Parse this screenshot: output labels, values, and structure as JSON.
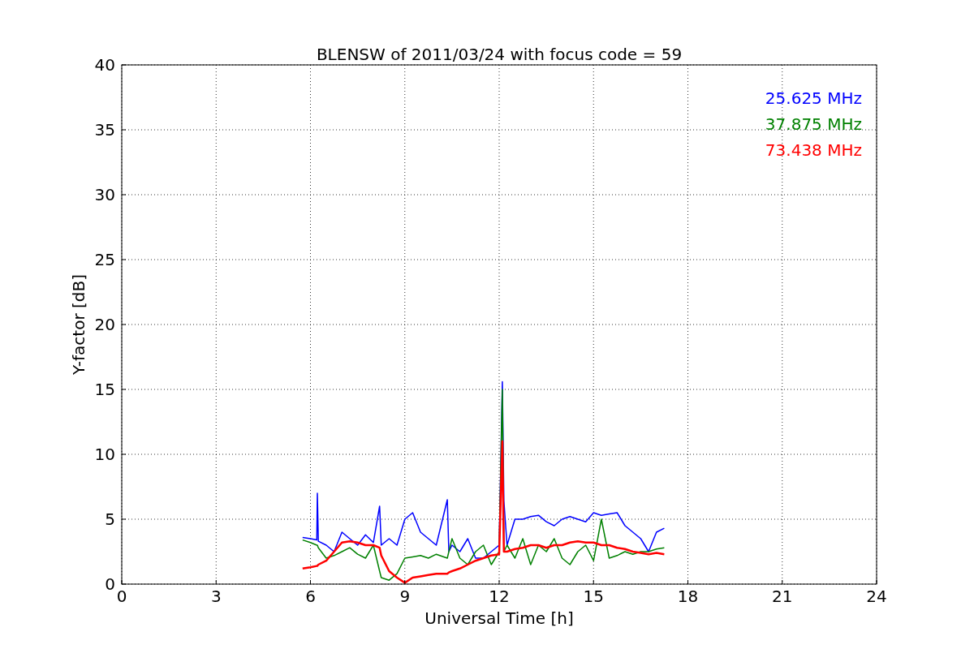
{
  "chart_data": {
    "type": "line",
    "grid": true,
    "title": "BLENSW of 2011/03/24 with focus code = 59",
    "xlabel": "Universal Time [h]",
    "ylabel": "Y-factor [dB]",
    "xlim": [
      0,
      24
    ],
    "ylim": [
      0,
      40
    ],
    "xticks": [
      0,
      3,
      6,
      9,
      12,
      15,
      18,
      21,
      24
    ],
    "yticks": [
      0,
      5,
      10,
      15,
      20,
      25,
      30,
      35,
      40
    ],
    "x": [
      5.75,
      6,
      6.2,
      6.22,
      6.25,
      6.5,
      6.75,
      7,
      7.25,
      7.5,
      7.75,
      8,
      8.2,
      8.25,
      8.5,
      8.75,
      9,
      9.25,
      9.5,
      9.75,
      10,
      10.35,
      10.4,
      10.5,
      10.75,
      11,
      11.25,
      11.5,
      11.75,
      12,
      12.1,
      12.15,
      12.25,
      12.5,
      12.75,
      13,
      13.25,
      13.5,
      13.75,
      14,
      14.25,
      14.5,
      14.75,
      15,
      15.25,
      15.5,
      15.75,
      16,
      16.25,
      16.5,
      16.75,
      17,
      17.25
    ],
    "series": [
      {
        "name": "25.625 MHz",
        "color": "#0000ff",
        "values": [
          3.6,
          3.5,
          3.4,
          7.0,
          3.3,
          3.0,
          2.5,
          4.0,
          3.5,
          3.0,
          3.8,
          3.2,
          6.0,
          3.0,
          3.5,
          3.0,
          5.0,
          5.5,
          4.0,
          3.5,
          3.0,
          6.5,
          2.5,
          3.0,
          2.5,
          3.5,
          2.0,
          2.0,
          2.5,
          3.0,
          15.6,
          6.4,
          3.0,
          5.0,
          5.0,
          5.2,
          5.3,
          4.8,
          4.5,
          5.0,
          5.2,
          5.0,
          4.8,
          5.5,
          5.3,
          5.4,
          5.5,
          4.5,
          4.0,
          3.5,
          2.5,
          4.0,
          4.3
        ]
      },
      {
        "name": "37.875 MHz",
        "color": "#008000",
        "values": [
          3.4,
          3.2,
          3.0,
          3.0,
          2.8,
          2.0,
          2.2,
          2.5,
          2.8,
          2.3,
          2.0,
          3.0,
          1.0,
          0.5,
          0.3,
          0.8,
          2.0,
          2.1,
          2.2,
          2.0,
          2.3,
          2.0,
          2.5,
          3.5,
          2.0,
          1.5,
          2.5,
          3.0,
          1.5,
          2.5,
          15.0,
          2.5,
          3.0,
          2.0,
          3.5,
          1.5,
          3.0,
          2.5,
          3.5,
          2.0,
          1.5,
          2.5,
          3.0,
          1.8,
          5.0,
          2.0,
          2.2,
          2.5,
          2.3,
          2.5,
          2.5,
          2.7,
          2.8
        ]
      },
      {
        "name": "73.438 MHz",
        "color": "#ff0000",
        "values": [
          1.2,
          1.3,
          1.4,
          1.4,
          1.5,
          1.8,
          2.5,
          3.2,
          3.3,
          3.2,
          3.0,
          3.0,
          2.8,
          2.2,
          1.0,
          0.5,
          0.1,
          0.5,
          0.6,
          0.7,
          0.8,
          0.8,
          0.9,
          1.0,
          1.2,
          1.5,
          1.8,
          2.0,
          2.2,
          2.3,
          11.0,
          2.5,
          2.5,
          2.7,
          2.8,
          3.0,
          3.0,
          2.8,
          3.0,
          3.0,
          3.2,
          3.3,
          3.2,
          3.2,
          3.0,
          3.0,
          2.8,
          2.7,
          2.5,
          2.4,
          2.3,
          2.4,
          2.3
        ]
      }
    ]
  }
}
